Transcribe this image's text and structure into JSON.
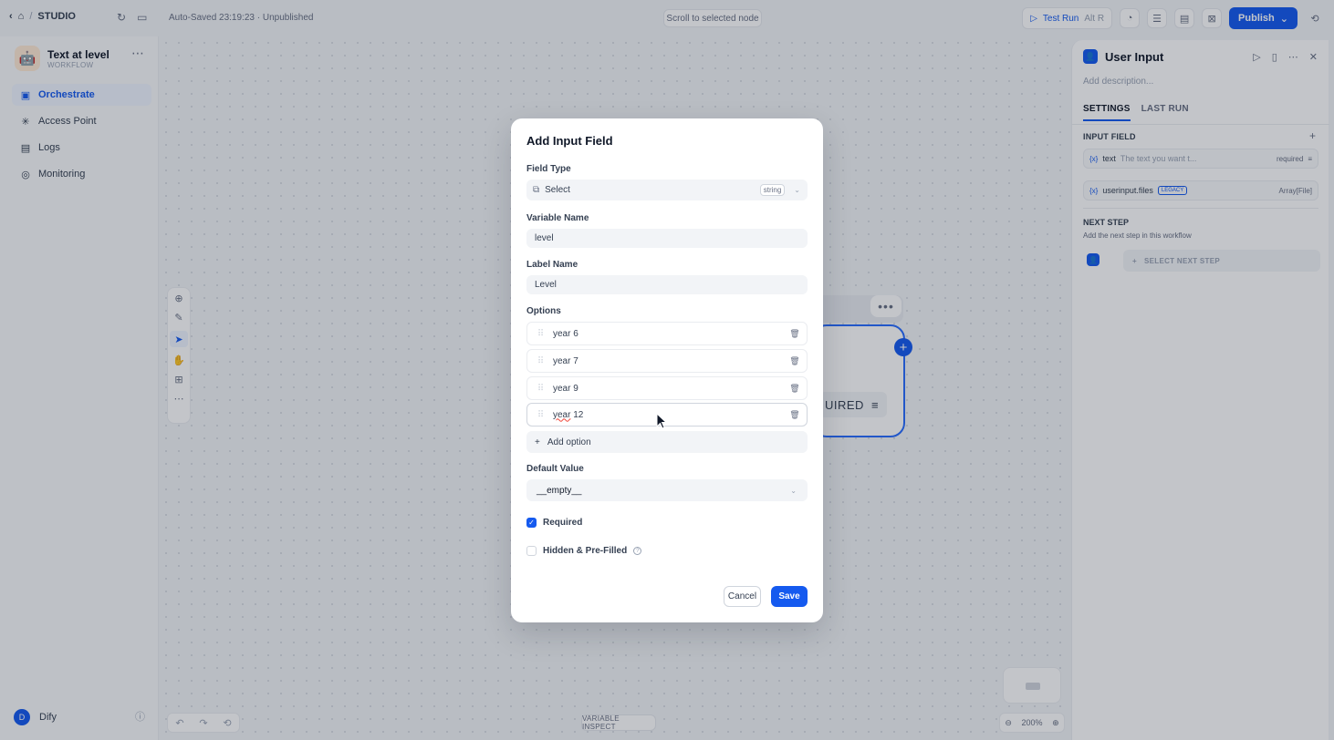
{
  "topbar": {
    "back_icon": "chevron-left-icon",
    "breadcrumb_sep": "/",
    "studio": "STUDIO",
    "autosave": "Auto-Saved 23:19:23 · Unpublished",
    "scroll_to_node": "Scroll to selected node",
    "test_run": "Test Run",
    "test_run_kbd": "Alt  R",
    "publish": "Publish"
  },
  "sidebar": {
    "app_name": "Text at level",
    "app_type": "WORKFLOW",
    "items": [
      {
        "label": "Orchestrate",
        "icon": "orchestrate-icon",
        "active": true
      },
      {
        "label": "Access Point",
        "icon": "access-point-icon",
        "active": false
      },
      {
        "label": "Logs",
        "icon": "logs-icon",
        "active": false
      },
      {
        "label": "Monitoring",
        "icon": "monitoring-icon",
        "active": false
      }
    ],
    "user_initial": "D",
    "user_name": "Dify"
  },
  "canvas": {
    "node_chip": "UIRED",
    "zoom": "200%",
    "variable_inspect": "VARIABLE INSPECT"
  },
  "panel": {
    "title": "User Input",
    "description_placeholder": "Add description...",
    "tabs": [
      "SETTINGS",
      "LAST RUN"
    ],
    "input_field_header": "INPUT FIELD",
    "fields": [
      {
        "var": "text",
        "desc": "The text you want t...",
        "meta": "required"
      },
      {
        "var": "userinput.files",
        "badge": "LEGACY",
        "meta": "Array[File]"
      }
    ],
    "next_step_header": "NEXT STEP",
    "next_step_desc": "Add the next step in this workflow",
    "select_next_step": "SELECT NEXT STEP"
  },
  "modal": {
    "title": "Add Input Field",
    "field_type_label": "Field Type",
    "field_type_value": "Select",
    "field_type_badge": "string",
    "variable_name_label": "Variable Name",
    "variable_name_value": "level",
    "label_name_label": "Label Name",
    "label_name_value": "Level",
    "options_label": "Options",
    "options": [
      "year 6",
      "year 7",
      "year 9"
    ],
    "last_option_word": "year",
    "last_option_rest": " 12",
    "add_option": "Add option",
    "default_value_label": "Default Value",
    "default_value": "__empty__",
    "required_label": "Required",
    "required_checked": true,
    "hidden_label": "Hidden & Pre-Filled",
    "hidden_checked": false,
    "cancel": "Cancel",
    "save": "Save"
  },
  "colors": {
    "accent": "#155aef",
    "overlay": "rgba(16,24,40,0.25)"
  }
}
